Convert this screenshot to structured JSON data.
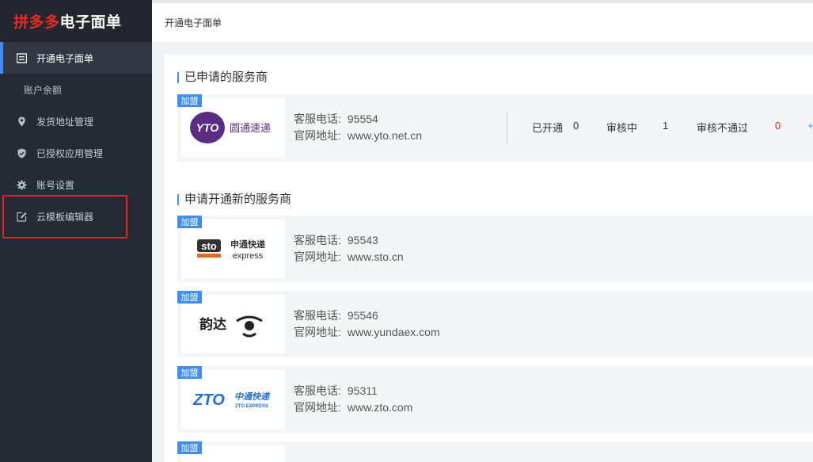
{
  "app": {
    "logo_brand": "拼多多",
    "logo_rest": "电子面单"
  },
  "sidebar": {
    "items": [
      {
        "label": "开通电子面单"
      },
      {
        "label": "账户余额"
      },
      {
        "label": "发货地址管理"
      },
      {
        "label": "已授权应用管理"
      },
      {
        "label": "账号设置"
      },
      {
        "label": "云模板编辑器"
      }
    ]
  },
  "breadcrumb": "开通电子面单",
  "sections": {
    "applied_title": "已申请的服务商",
    "new_title": "申请开通新的服务商"
  },
  "labels": {
    "badge": "加盟",
    "phone": "客服电话:",
    "website": "官网地址:"
  },
  "applied": {
    "name": "圆通速递",
    "logo_mark": "YTO",
    "phone": "95554",
    "website": "www.yto.net.cn",
    "stats": {
      "opened_label": "已开通",
      "opened_value": "0",
      "reviewing_label": "审核中",
      "reviewing_value": "1",
      "rejected_label": "审核不通过",
      "rejected_value": "0",
      "more": "+"
    }
  },
  "providers": [
    {
      "name": "申通快递",
      "logo_mark": "sto",
      "sub": "express",
      "phone": "95543",
      "website": "www.sto.cn"
    },
    {
      "name": "韵达",
      "logo_mark": "韵达",
      "sub": "",
      "phone": "95546",
      "website": "www.yundaex.com"
    },
    {
      "name": "中通快递",
      "logo_mark": "ZTO",
      "sub": "ZTO EXPRESS",
      "phone": "95311",
      "website": "www.zto.com"
    }
  ],
  "colors": {
    "brand_red": "#e02e24",
    "accent_blue": "#3e8ef7",
    "sidebar_bg": "#262a35"
  }
}
